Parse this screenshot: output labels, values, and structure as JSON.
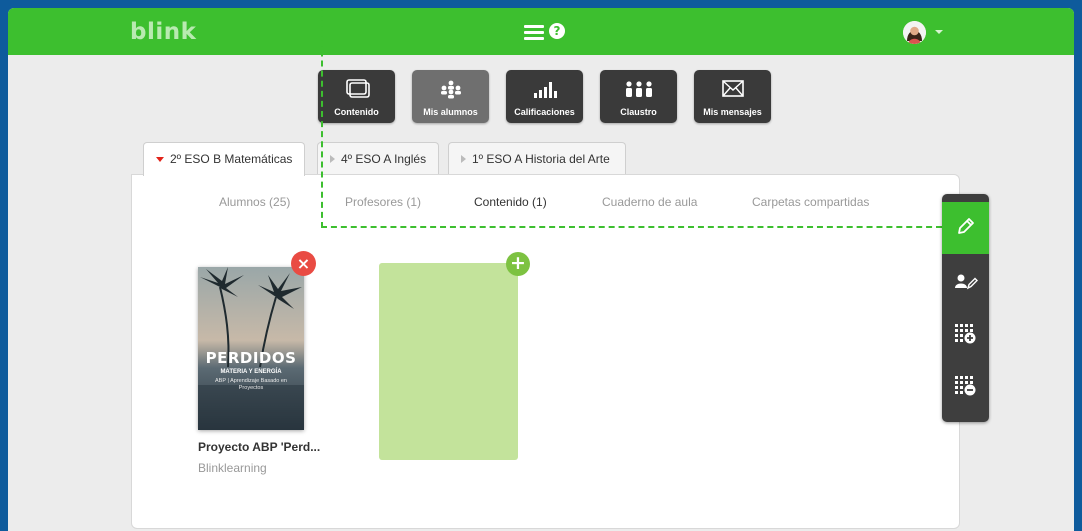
{
  "app": {
    "logo": "blink",
    "help_label": "?"
  },
  "colors": {
    "brand_green": "#3dbf2f",
    "frame_blue": "#0e5b9c",
    "toolbar_dark": "#3a3a3a",
    "toolbar_active": "#6f6f6f",
    "remove_red": "#e94b43",
    "add_green": "#7dc241",
    "placeholder_green": "#c3e39b"
  },
  "toolbar": [
    {
      "label": "Contenido",
      "icon": "content-icon"
    },
    {
      "label": "Mis alumnos",
      "icon": "students-icon"
    },
    {
      "label": "Calificaciones",
      "icon": "grades-icon"
    },
    {
      "label": "Claustro",
      "icon": "staff-icon"
    },
    {
      "label": "Mis mensajes",
      "icon": "envelope-icon"
    }
  ],
  "tabs": [
    {
      "label": "2º ESO B Matemáticas",
      "active": true
    },
    {
      "label": "4º ESO A Inglés",
      "active": false
    },
    {
      "label": "1º ESO A Historia del Arte",
      "active": false
    }
  ],
  "subnav": [
    {
      "label": "Alumnos (25)"
    },
    {
      "label": "Profesores (1)"
    },
    {
      "label": "Contenido (1)",
      "active": true
    },
    {
      "label": "Cuaderno de aula"
    },
    {
      "label": "Carpetas compartidas"
    }
  ],
  "content_card": {
    "cover_title": "PERDIDOS",
    "cover_subtitle": "MATERIA Y ENERGÍA",
    "cover_desc": "ABP | Aprendizaje Basado en Proyectos",
    "title": "Proyecto ABP 'Perd...",
    "author": "Blinklearning",
    "remove_label": "×"
  },
  "add_slot": {
    "add_label": "+"
  },
  "side_toolbar": [
    {
      "icon": "pencil-icon",
      "active": true
    },
    {
      "icon": "user-edit-icon"
    },
    {
      "icon": "grid-add-icon"
    },
    {
      "icon": "grid-remove-icon"
    }
  ]
}
